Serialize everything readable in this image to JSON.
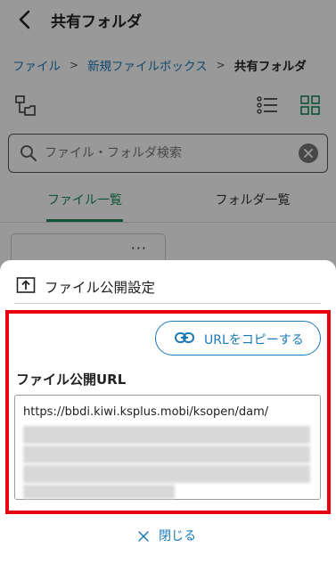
{
  "header": {
    "title": "共有フォルダ"
  },
  "breadcrumb": {
    "items": [
      "ファイル",
      "新規ファイルボックス",
      "共有フォルダ"
    ],
    "separator": ">"
  },
  "search": {
    "placeholder": "ファイル・フォルダ検索",
    "value": ""
  },
  "tabs": [
    {
      "label": "ファイル一覧",
      "active": true
    },
    {
      "label": "フォルダ一覧",
      "active": false
    }
  ],
  "file_card": {
    "menu_label": "···"
  },
  "sheet": {
    "title": "ファイル公開設定",
    "copy_button_label": "URLをコピーする",
    "url_heading": "ファイル公開URL",
    "url_value": "https://bbdi.kiwi.ksplus.mobi/ksopen/dam/",
    "close_label": "閉じる"
  },
  "colors": {
    "accent_green": "#1b8a5a",
    "link_blue": "#1a7ab8",
    "highlight_red": "#e8000f"
  },
  "icons": {
    "back": "back-arrow-icon",
    "folder_tree": "folder-tree-icon",
    "list_view": "list-view-icon",
    "grid_view": "grid-view-icon",
    "search": "search-icon",
    "clear": "clear-icon",
    "share": "share-upload-icon",
    "link": "link-icon",
    "close": "close-icon"
  }
}
